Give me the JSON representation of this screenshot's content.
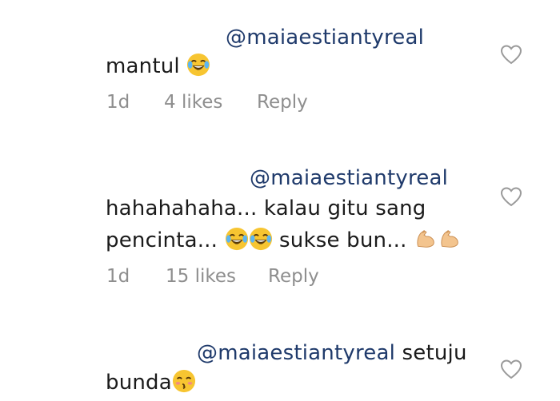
{
  "comments": [
    {
      "mention": "@maiaestiantyreal",
      "text_after_mention": "",
      "line1": "mantul",
      "line2": "",
      "line2_suffix": "",
      "emojis": [
        "face-with-tears-of-joy-icon"
      ],
      "age": "1d",
      "likes": "4 likes",
      "reply_label": "Reply"
    },
    {
      "mention": "@maiaestiantyreal",
      "text_after_mention": "",
      "line1": "hahahahaha... kalau gitu sang",
      "line2": "pencinta...",
      "line2_suffix": "sukse bun...",
      "emojis": [
        "face-with-tears-of-joy-icon",
        "face-with-tears-of-joy-icon",
        "flexed-biceps-icon",
        "flexed-biceps-icon"
      ],
      "age": "1d",
      "likes": "15 likes",
      "reply_label": "Reply"
    },
    {
      "mention": "@maiaestiantyreal",
      "text_after_mention": "setuju",
      "line1": "bunda",
      "line2": "",
      "line2_suffix": "",
      "emojis": [
        "kissing-face-with-smiling-eyes-icon"
      ],
      "age": "",
      "likes": "",
      "reply_label": ""
    }
  ],
  "colors": {
    "mention": "#1f3a6b",
    "meta": "#8e8e8e",
    "emoji_yellow": "#f7c531",
    "heart_stroke": "#9a9a9a"
  }
}
